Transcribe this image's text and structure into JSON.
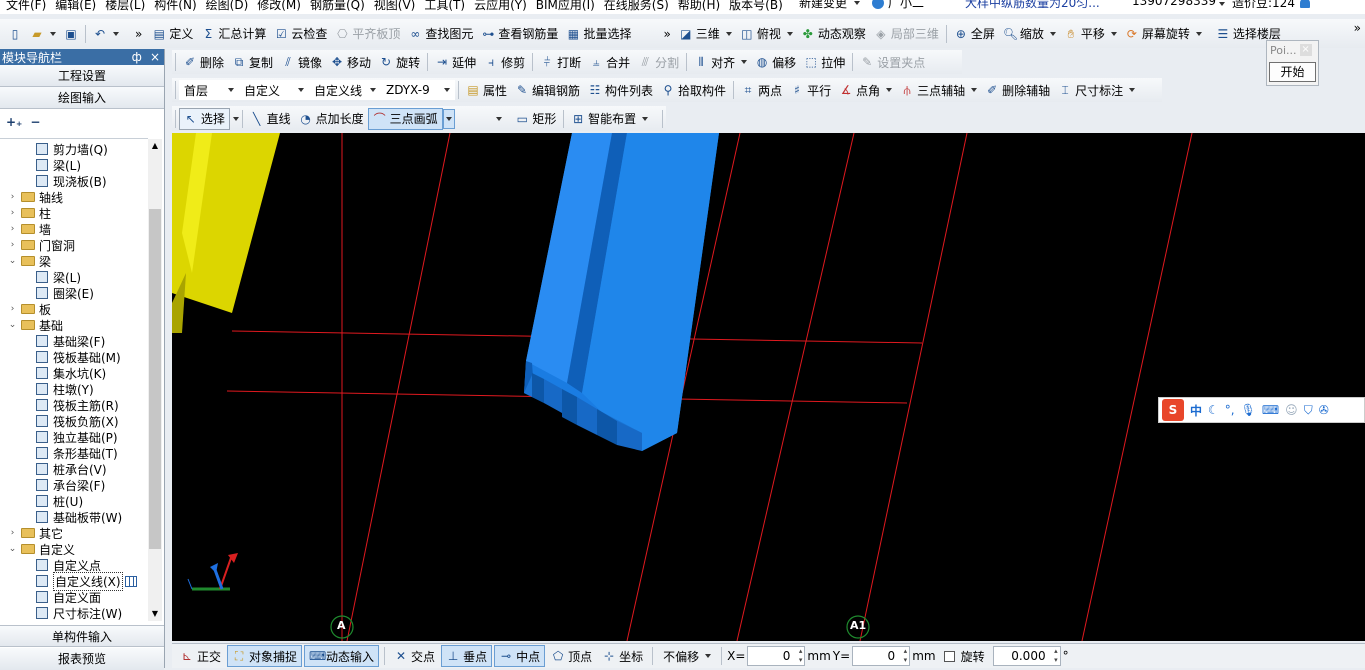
{
  "menubar": {
    "items": [
      "文件(F)",
      "编辑(E)",
      "楼层(L)",
      "构件(N)",
      "绘图(D)",
      "修改(M)",
      "钢筋量(Q)",
      "视图(V)",
      "工具(T)",
      "云应用(Y)",
      "BIM应用(I)",
      "在线服务(S)",
      "帮助(H)",
      "版本号(B)"
    ],
    "new_change": "新建变更",
    "user": "广小二",
    "notice": "大样中纵筋数量为20匀...",
    "phone": "13907298339",
    "beans": "造价豆:124"
  },
  "toolbar1": {
    "define": "定义",
    "summary": "汇总计算",
    "cloud_check": "云检查",
    "align_slab": "平齐板顶",
    "find": "查找图元",
    "view_rebar": "查看钢筋量",
    "batch_select": "批量选择",
    "view3d": "三维",
    "top_view": "俯视",
    "dynamic": "动态观察",
    "local3d": "局部三维",
    "fullscreen": "全屏",
    "zoom": "缩放",
    "pan": "平移",
    "rotate_screen": "屏幕旋转",
    "select_floor": "选择楼层"
  },
  "popup": {
    "title": "Poi...",
    "start": "开始"
  },
  "panel": {
    "title": "模块导航栏",
    "pin": "ф",
    "close": "×",
    "project_settings": "工程设置",
    "draw_input": "绘图输入",
    "single_input": "单构件输入",
    "report_preview": "报表预览"
  },
  "tree": [
    {
      "label": "剪力墙(Q)",
      "level": 2
    },
    {
      "label": "梁(L)",
      "level": 2
    },
    {
      "label": "现浇板(B)",
      "level": 2
    },
    {
      "label": "轴线",
      "level": 1,
      "toggle": "›"
    },
    {
      "label": "柱",
      "level": 1,
      "toggle": "›"
    },
    {
      "label": "墙",
      "level": 1,
      "toggle": "›"
    },
    {
      "label": "门窗洞",
      "level": 1,
      "toggle": "›"
    },
    {
      "label": "梁",
      "level": 1,
      "toggle": "⌄"
    },
    {
      "label": "梁(L)",
      "level": 2
    },
    {
      "label": "圈梁(E)",
      "level": 2
    },
    {
      "label": "板",
      "level": 1,
      "toggle": "›"
    },
    {
      "label": "基础",
      "level": 1,
      "toggle": "⌄"
    },
    {
      "label": "基础梁(F)",
      "level": 2
    },
    {
      "label": "筏板基础(M)",
      "level": 2
    },
    {
      "label": "集水坑(K)",
      "level": 2
    },
    {
      "label": "柱墩(Y)",
      "level": 2
    },
    {
      "label": "筏板主筋(R)",
      "level": 2
    },
    {
      "label": "筏板负筋(X)",
      "level": 2
    },
    {
      "label": "独立基础(P)",
      "level": 2
    },
    {
      "label": "条形基础(T)",
      "level": 2
    },
    {
      "label": "桩承台(V)",
      "level": 2
    },
    {
      "label": "承台梁(F)",
      "level": 2
    },
    {
      "label": "桩(U)",
      "level": 2
    },
    {
      "label": "基础板带(W)",
      "level": 2
    },
    {
      "label": "其它",
      "level": 1,
      "toggle": "›"
    },
    {
      "label": "自定义",
      "level": 1,
      "toggle": "⌄"
    },
    {
      "label": "自定义点",
      "level": 2
    },
    {
      "label": "自定义线(X)",
      "level": 2,
      "selected": true
    },
    {
      "label": "自定义面",
      "level": 2
    },
    {
      "label": "尺寸标注(W)",
      "level": 2
    }
  ],
  "toolbar2": {
    "delete": "删除",
    "copy": "复制",
    "mirror": "镜像",
    "move": "移动",
    "rotate": "旋转",
    "extend": "延伸",
    "trim": "修剪",
    "break": "打断",
    "merge": "合并",
    "split": "分割",
    "align": "对齐",
    "offset": "偏移",
    "stretch": "拉伸",
    "set_point": "设置夹点"
  },
  "toolbar3": {
    "floor": "首层",
    "category": "自定义",
    "type": "自定义线",
    "element": "ZDYX-9",
    "property": "属性",
    "edit_rebar": "编辑钢筋",
    "component_list": "构件列表",
    "pick": "拾取构件",
    "two_point": "两点",
    "parallel": "平行",
    "point_angle": "点角",
    "three_point_aux": "三点辅轴",
    "delete_aux": "删除辅轴",
    "dimension": "尺寸标注"
  },
  "toolbar4": {
    "select": "选择",
    "line": "直线",
    "point_length": "点加长度",
    "arc3": "三点画弧",
    "rect": "矩形",
    "smart": "智能布置"
  },
  "viewport": {
    "axis_labels": [
      "A",
      "A1"
    ],
    "ime": {
      "logo": "S",
      "lang": "中"
    }
  },
  "statusbar": {
    "ortho": "正交",
    "snap": "对象捕捉",
    "dyn_input": "动态输入",
    "intersect": "交点",
    "perp": "垂点",
    "mid": "中点",
    "vertex": "顶点",
    "coord": "坐标",
    "offset_mode": "不偏移",
    "x_label": "X=",
    "x_val": "0",
    "y_label": "Y=",
    "y_val": "0",
    "unit": "mm",
    "rotate": "旋转",
    "rotate_val": "0.000",
    "deg": "°"
  },
  "colors": {
    "yellow_beam": "#d8d200",
    "blue_beam": "#1c7fe0",
    "grid_red": "#e0191f",
    "axis_green": "#1f8a2e"
  }
}
